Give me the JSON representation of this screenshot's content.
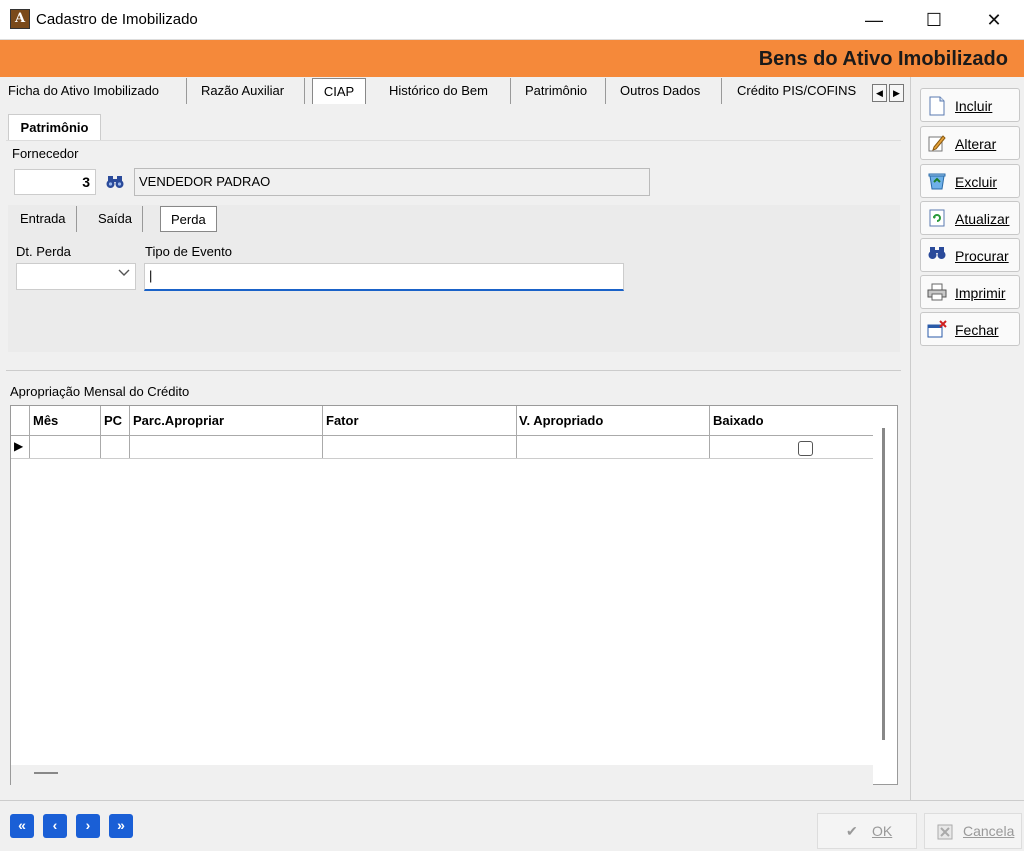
{
  "window": {
    "title": "Cadastro de Imobilizado",
    "icon": "app-logo-icon"
  },
  "header": {
    "title": "Bens do Ativo Imobilizado",
    "accent_color": "#f5893a"
  },
  "tabs": [
    {
      "label": "Ficha do Ativo Imobilizado"
    },
    {
      "label": "Razão Auxiliar"
    },
    {
      "label": "CIAP",
      "active": true
    },
    {
      "label": "Histórico do Bem"
    },
    {
      "label": "Patrimônio"
    },
    {
      "label": "Outros Dados"
    },
    {
      "label": "Crédito PIS/COFINS"
    }
  ],
  "patrimonio": {
    "tab_label": "Patrimônio",
    "fornecedor_label": "Fornecedor",
    "fornecedor_code": "3",
    "fornecedor_name": "VENDEDOR PADRAO",
    "subtabs": [
      {
        "label": "Entrada"
      },
      {
        "label": "Saída"
      },
      {
        "label": "Perda",
        "active": true
      }
    ],
    "dt_perda_label": "Dt. Perda",
    "dt_perda_value": "",
    "tipo_evento_label": "Tipo de Evento",
    "tipo_evento_value": "|"
  },
  "apropriacao": {
    "label": "Apropriação Mensal do Crédito",
    "columns": [
      "Mês",
      "PC",
      "Parc.Apropriar",
      "Fator",
      "V. Apropriado",
      "Baixado"
    ],
    "rows": [
      {
        "mes": "",
        "pc": "",
        "parc": "",
        "fator": "",
        "v_apropriado": "",
        "baixado": false
      }
    ]
  },
  "toolbar": {
    "incluir": "Incluir",
    "alterar": "Alterar",
    "excluir": "Excluir",
    "atualizar": "Atualizar",
    "procurar": "Procurar",
    "imprimir": "Imprimir",
    "fechar": "Fechar"
  },
  "footer": {
    "ok": "OK",
    "cancela": "Cancela",
    "nav": [
      "first",
      "previous",
      "next",
      "last"
    ]
  }
}
